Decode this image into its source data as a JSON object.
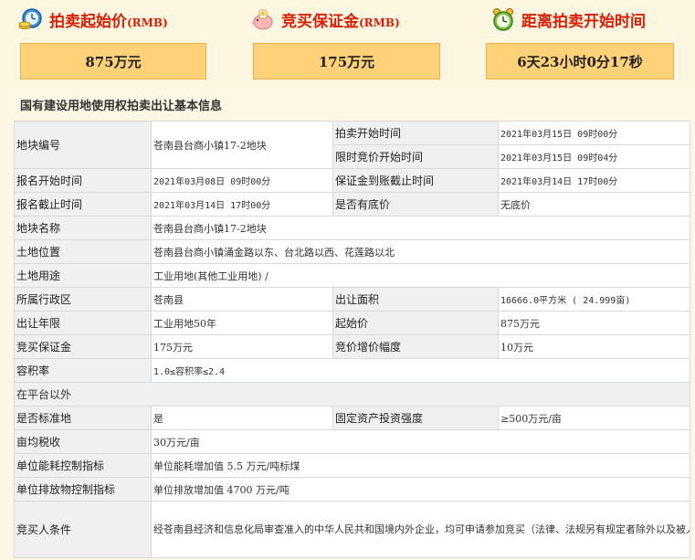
{
  "stats": {
    "start_price": {
      "title": "拍卖起始价",
      "unit": "(RMB)",
      "value": "875万元",
      "icon": "money-clock-icon"
    },
    "deposit": {
      "title": "竞买保证金",
      "unit": "(RMB)",
      "value": "175万元",
      "icon": "piggy-bank-icon"
    },
    "countdown": {
      "title": "距离拍卖开始时间",
      "value": "6天23小时0分17秒",
      "icon": "alarm-clock-icon"
    }
  },
  "section": {
    "title": "国有建设用地使用权拍卖出让基本信息"
  },
  "rows": {
    "parcel_no": {
      "label": "地块编号",
      "value": "苍南县台商小镇17-2地块"
    },
    "auction_start": {
      "label": "拍卖开始时间",
      "value": "2021年03月15日 09时00分"
    },
    "bidding_start": {
      "label": "限时竞价开始时间",
      "value": "2021年03月15日 09时04分"
    },
    "reg_start": {
      "label": "报名开始时间",
      "value": "2021年03月08日 09时00分"
    },
    "deposit_deadline": {
      "label": "保证金到账截止时间",
      "value": "2021年03月14日 17时00分"
    },
    "reg_end": {
      "label": "报名截止时间",
      "value": "2021年03月14日 17时00分"
    },
    "reserve": {
      "label": "是否有底价",
      "value": "无底价"
    },
    "parcel_name": {
      "label": "地块名称",
      "value": "苍南县台商小镇17-2地块"
    },
    "location": {
      "label": "土地位置",
      "value": "苍南县台商小镇涌金路以东、台北路以西、花莲路以北"
    },
    "usage": {
      "label": "土地用途",
      "value": "工业用地(其他工业用地) /"
    },
    "district": {
      "label": "所属行政区",
      "value": "苍南县"
    },
    "area": {
      "label": "出让面积",
      "value": "16666.0平方米 ( 24.999亩)"
    },
    "term": {
      "label": "出让年限",
      "value": "工业用地50年"
    },
    "start_price": {
      "label": "起始价",
      "value": "875万元"
    },
    "deposit": {
      "label": "竞买保证金",
      "value": "175万元"
    },
    "increment": {
      "label": "竞价增价幅度",
      "value": "10万元"
    },
    "far": {
      "label": "容积率",
      "value": "1.0≤容积率≤2.4"
    },
    "other": {
      "label": "在平台以外"
    },
    "standard": {
      "label": "是否标准地",
      "value": "是"
    },
    "investment": {
      "label": "固定资产投资强度",
      "value": "≥500万元/亩"
    },
    "tax": {
      "label": "亩均税收",
      "value": "30万元/亩"
    },
    "energy": {
      "label": "单位能耗控制指标",
      "value": "单位能耗增加值 5.5 万元/吨标煤"
    },
    "emission": {
      "label": "单位排放物控制指标",
      "value": "单位排放增加值 4700 万元/吨"
    },
    "bidder": {
      "label": "竞买人条件",
      "value": "经苍南县经济和信息化局审查准入的中华人民共和国境内外企业，均可申请参加竞买（法律、法规另有规定者除外以及被人民法院列入限制失信被执行人投标资格名单的禁止参加）。"
    }
  }
}
